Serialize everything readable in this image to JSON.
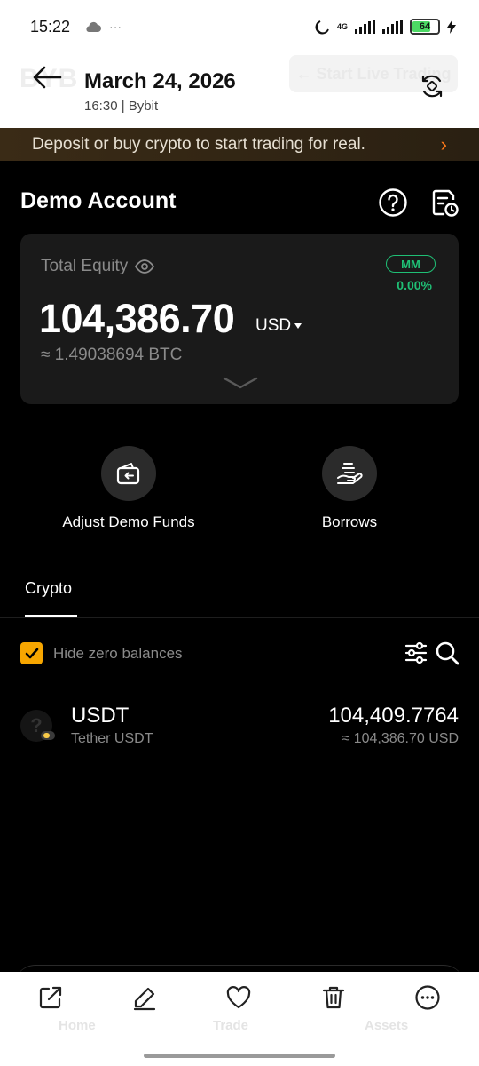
{
  "status_bar": {
    "time": "15:22",
    "dots": "···",
    "network": "4G",
    "battery": "64"
  },
  "header": {
    "date": "March 24, 2026",
    "subtitle": "16:30 | Bybit",
    "ghost_logo": "BYB",
    "ghost_button": "← Start Live Trading"
  },
  "banner": {
    "text": "Deposit or buy crypto to start trading for real.",
    "arrow": "›"
  },
  "page": {
    "title": "Demo Account"
  },
  "equity": {
    "label": "Total Equity",
    "value": "104,386.70",
    "unit": "USD",
    "btc": "≈ 1.49038694 BTC",
    "mm_label": "MM",
    "mm_value": "0.00%"
  },
  "actions": [
    {
      "label": "Adjust Demo Funds",
      "icon": "wallet-icon"
    },
    {
      "label": "Borrows",
      "icon": "hand-coins-icon"
    }
  ],
  "tabs": [
    {
      "label": "Crypto",
      "active": true
    }
  ],
  "filter": {
    "hide_zero_label": "Hide zero balances",
    "hide_zero_checked": true
  },
  "assets": [
    {
      "symbol": "USDT",
      "name": "Tether USDT",
      "amount": "104,409.7764",
      "usd": "≈ 104,386.70 USD"
    }
  ],
  "bottom_ghost_nav": [
    "Home",
    "Trade",
    "Assets"
  ],
  "toolbar_icons": [
    "share-icon",
    "edit-icon",
    "heart-icon",
    "delete-icon",
    "more-icon"
  ],
  "colors": {
    "accent": "#f7a600",
    "positive": "#1fbf75",
    "banner_arrow": "#ff7a1a"
  }
}
